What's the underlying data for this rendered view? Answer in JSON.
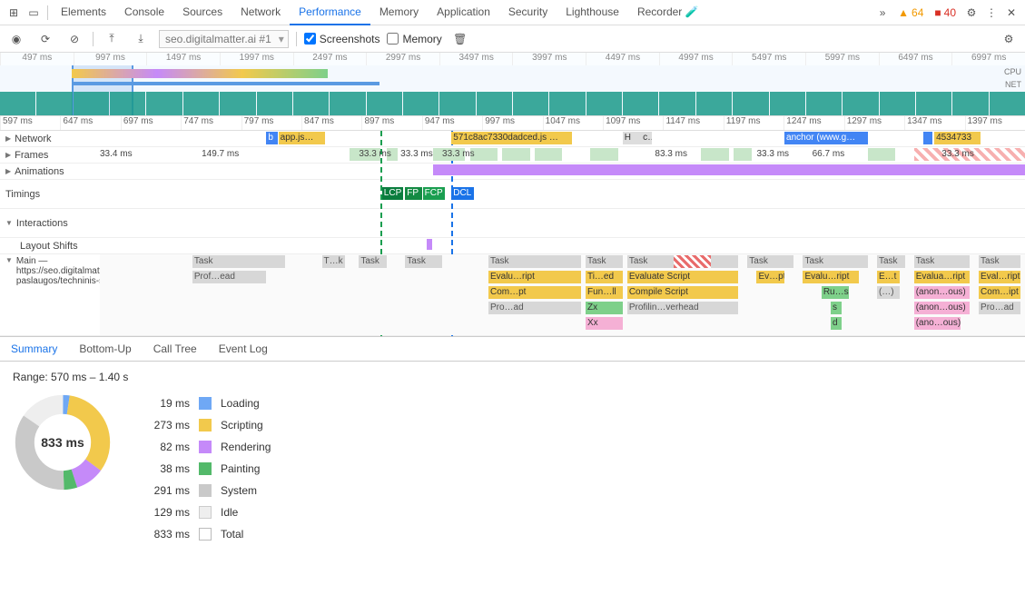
{
  "devtools": {
    "tabs": [
      "Elements",
      "Console",
      "Sources",
      "Network",
      "Performance",
      "Memory",
      "Application",
      "Security",
      "Lighthouse",
      "Recorder 🧪"
    ],
    "active_tab": "Performance",
    "warnings": "64",
    "errors": "40"
  },
  "toolbar": {
    "recording_select": "seo.digitalmatter.ai #1",
    "screenshots_label": "Screenshots",
    "screenshots_checked": true,
    "memory_label": "Memory",
    "memory_checked": false
  },
  "overview": {
    "ticks": [
      "497 ms",
      "997 ms",
      "1497 ms",
      "1997 ms",
      "2497 ms",
      "2997 ms",
      "3497 ms",
      "3997 ms",
      "4497 ms",
      "4997 ms",
      "5497 ms",
      "5997 ms",
      "6497 ms",
      "6997 ms"
    ],
    "lanes": [
      "CPU",
      "NET"
    ]
  },
  "ruler": [
    "597 ms",
    "647 ms",
    "697 ms",
    "747 ms",
    "797 ms",
    "847 ms",
    "897 ms",
    "947 ms",
    "997 ms",
    "1047 ms",
    "1097 ms",
    "1147 ms",
    "1197 ms",
    "1247 ms",
    "1297 ms",
    "1347 ms",
    "1397 ms"
  ],
  "tracks": {
    "network": {
      "label": "Network",
      "items": [
        {
          "cls": "net-b",
          "l": 18,
          "w": 1.2,
          "t": "b"
        },
        {
          "cls": "net-y",
          "l": 19.3,
          "w": 5,
          "t": "app.js…"
        },
        {
          "cls": "net-y",
          "l": 38,
          "w": 13,
          "t": "571c8ac7330dadced.js …"
        },
        {
          "cls": "net-gr",
          "l": 56.5,
          "w": 2,
          "t": "H"
        },
        {
          "cls": "net-gr",
          "l": 58.5,
          "w": 1.2,
          "t": "c…"
        },
        {
          "cls": "net-b",
          "l": 74,
          "w": 9,
          "t": "anchor (www.g…"
        },
        {
          "cls": "net-b",
          "l": 89,
          "w": 1,
          "t": ""
        },
        {
          "cls": "net-y",
          "l": 90.2,
          "w": 5,
          "t": "4534733"
        }
      ]
    },
    "frames": {
      "label": "Frames",
      "texts": [
        {
          "l": 0,
          "t": "33.4 ms"
        },
        {
          "l": 11,
          "t": "149.7 ms"
        },
        {
          "l": 28,
          "t": "33.3 ms"
        },
        {
          "l": 32.5,
          "t": "33.3 ms"
        },
        {
          "l": 37,
          "t": "33.3 ms"
        },
        {
          "l": 60,
          "t": "83.3 ms"
        },
        {
          "l": 71,
          "t": "33.3 ms"
        },
        {
          "l": 77,
          "t": "66.7 ms"
        },
        {
          "l": 91,
          "t": "33.3 ms"
        }
      ],
      "bars": [
        {
          "cls": "frame-g",
          "l": 27,
          "w": 3.3
        },
        {
          "cls": "frame-g",
          "l": 31,
          "w": 1.2
        },
        {
          "cls": "frame-g",
          "l": 36,
          "w": 3.5
        },
        {
          "cls": "frame-g",
          "l": 40,
          "w": 3
        },
        {
          "cls": "frame-g",
          "l": 43.5,
          "w": 3
        },
        {
          "cls": "frame-g",
          "l": 47,
          "w": 3
        },
        {
          "cls": "frame-g",
          "l": 53,
          "w": 3
        },
        {
          "cls": "frame-g",
          "l": 65,
          "w": 3
        },
        {
          "cls": "frame-g",
          "l": 68.5,
          "w": 2
        },
        {
          "cls": "frame-g",
          "l": 83,
          "w": 3
        },
        {
          "cls": "frame-r",
          "l": 88,
          "w": 12
        }
      ]
    },
    "animations": {
      "label": "Animations",
      "bar": {
        "l": 36,
        "w": 64
      }
    },
    "timings": {
      "label": "Timings",
      "items": [
        {
          "cls": "timing-lcp",
          "l": 30.5,
          "w": 2.3,
          "t": "LCP"
        },
        {
          "cls": "timing-fp",
          "l": 33,
          "w": 1.8,
          "t": "FP"
        },
        {
          "cls": "timing-fcp",
          "l": 34.9,
          "w": 2.4,
          "t": "FCP"
        },
        {
          "cls": "timing-dcl",
          "l": 38,
          "w": 2.4,
          "t": "DCL"
        }
      ]
    },
    "interactions": {
      "label": "Interactions"
    },
    "layoutshifts": {
      "label": "Layout Shifts",
      "bar": {
        "l": 35.3,
        "w": 0.6
      }
    },
    "main": {
      "label": "Main — https://seo.digitalmatter.ai/lt/seo-paslaugos/techninis-seo-auditas",
      "rows": [
        [
          {
            "cls": "task-gray",
            "l": 10,
            "w": 10,
            "t": "Task"
          },
          {
            "cls": "task-gray",
            "l": 24,
            "w": 2.5,
            "t": "T…k"
          },
          {
            "cls": "task-gray",
            "l": 28,
            "w": 3,
            "t": "Task"
          },
          {
            "cls": "task-gray",
            "l": 33,
            "w": 4,
            "t": "Task"
          },
          {
            "cls": "task-gray",
            "l": 42,
            "w": 10,
            "t": "Task"
          },
          {
            "cls": "task-gray",
            "l": 52.5,
            "w": 4,
            "t": "Task"
          },
          {
            "cls": "task-gray",
            "l": 57,
            "w": 12,
            "t": "Task"
          },
          {
            "cls": "task-r",
            "l": 62,
            "w": 4,
            "t": ""
          },
          {
            "cls": "task-gray",
            "l": 70,
            "w": 5,
            "t": "Task"
          },
          {
            "cls": "task-gray",
            "l": 76,
            "w": 7,
            "t": "Task"
          },
          {
            "cls": "task-gray",
            "l": 84,
            "w": 3,
            "t": "Task"
          },
          {
            "cls": "task-gray",
            "l": 88,
            "w": 6,
            "t": "Task"
          },
          {
            "cls": "task-gray",
            "l": 95,
            "w": 4.5,
            "t": "Task"
          }
        ],
        [
          {
            "cls": "task-gray",
            "l": 10,
            "w": 8,
            "t": "Prof…ead"
          },
          {
            "cls": "task-y",
            "l": 42,
            "w": 10,
            "t": "Evalu…ript"
          },
          {
            "cls": "task-y",
            "l": 52.5,
            "w": 4,
            "t": "Ti…ed"
          },
          {
            "cls": "task-y",
            "l": 57,
            "w": 12,
            "t": "Evaluate Script"
          },
          {
            "cls": "task-y",
            "l": 71,
            "w": 3,
            "t": "Ev…pt"
          },
          {
            "cls": "task-y",
            "l": 76,
            "w": 6,
            "t": "Evalu…ript"
          },
          {
            "cls": "task-y",
            "l": 84,
            "w": 2.5,
            "t": "E…t"
          },
          {
            "cls": "task-y",
            "l": 88,
            "w": 6,
            "t": "Evalua…ript"
          },
          {
            "cls": "task-y",
            "l": 95,
            "w": 4.5,
            "t": "Eval…ript"
          }
        ],
        [
          {
            "cls": "task-y",
            "l": 42,
            "w": 10,
            "t": "Com…pt"
          },
          {
            "cls": "task-y",
            "l": 52.5,
            "w": 4,
            "t": "Fun…ll"
          },
          {
            "cls": "task-y",
            "l": 57,
            "w": 12,
            "t": "Compile Script"
          },
          {
            "cls": "task-g",
            "l": 78,
            "w": 3,
            "t": "Ru…s"
          },
          {
            "cls": "task-gray",
            "l": 84,
            "w": 2.5,
            "t": "(…)"
          },
          {
            "cls": "task-pk",
            "l": 88,
            "w": 6,
            "t": "(anon…ous)"
          },
          {
            "cls": "task-y",
            "l": 95,
            "w": 4.5,
            "t": "Com…ipt"
          }
        ],
        [
          {
            "cls": "task-gray",
            "l": 42,
            "w": 10,
            "t": "Pro…ad"
          },
          {
            "cls": "task-g",
            "l": 52.5,
            "w": 4,
            "t": "Zx"
          },
          {
            "cls": "task-gray",
            "l": 57,
            "w": 12,
            "t": "Profilin…verhead"
          },
          {
            "cls": "task-g",
            "l": 79,
            "w": 1.2,
            "t": "s"
          },
          {
            "cls": "task-pk",
            "l": 88,
            "w": 6,
            "t": "(anon…ous)"
          },
          {
            "cls": "task-gray",
            "l": 95,
            "w": 4.5,
            "t": "Pro…ad"
          }
        ],
        [
          {
            "cls": "task-pk",
            "l": 52.5,
            "w": 4,
            "t": "Xx"
          },
          {
            "cls": "task-g",
            "l": 79,
            "w": 1.2,
            "t": "d"
          },
          {
            "cls": "task-pk",
            "l": 88,
            "w": 5,
            "t": "(ano…ous)"
          }
        ]
      ]
    }
  },
  "bottom_tabs": [
    "Summary",
    "Bottom-Up",
    "Call Tree",
    "Event Log"
  ],
  "bottom_active": "Summary",
  "summary": {
    "range": "Range: 570 ms – 1.40 s",
    "total_label": "833 ms",
    "legend": [
      {
        "ms": "19 ms",
        "sw": "sw-loading",
        "name": "Loading"
      },
      {
        "ms": "273 ms",
        "sw": "sw-scripting",
        "name": "Scripting"
      },
      {
        "ms": "82 ms",
        "sw": "sw-rendering",
        "name": "Rendering"
      },
      {
        "ms": "38 ms",
        "sw": "sw-painting",
        "name": "Painting"
      },
      {
        "ms": "291 ms",
        "sw": "sw-system",
        "name": "System"
      },
      {
        "ms": "129 ms",
        "sw": "sw-idle",
        "name": "Idle"
      },
      {
        "ms": "833 ms",
        "sw": "sw-total",
        "name": "Total"
      }
    ]
  },
  "chart_data": {
    "type": "pie",
    "title": "Range: 570 ms – 1.40 s",
    "series": [
      {
        "name": "Loading",
        "value": 19,
        "color": "#6fa8f5"
      },
      {
        "name": "Scripting",
        "value": 273,
        "color": "#f2c94c"
      },
      {
        "name": "Rendering",
        "value": 82,
        "color": "#c58af9"
      },
      {
        "name": "Painting",
        "value": 38,
        "color": "#53b96a"
      },
      {
        "name": "System",
        "value": 291,
        "color": "#c9c9c9"
      },
      {
        "name": "Idle",
        "value": 129,
        "color": "#eeeeee"
      }
    ],
    "total": 833,
    "unit": "ms"
  }
}
